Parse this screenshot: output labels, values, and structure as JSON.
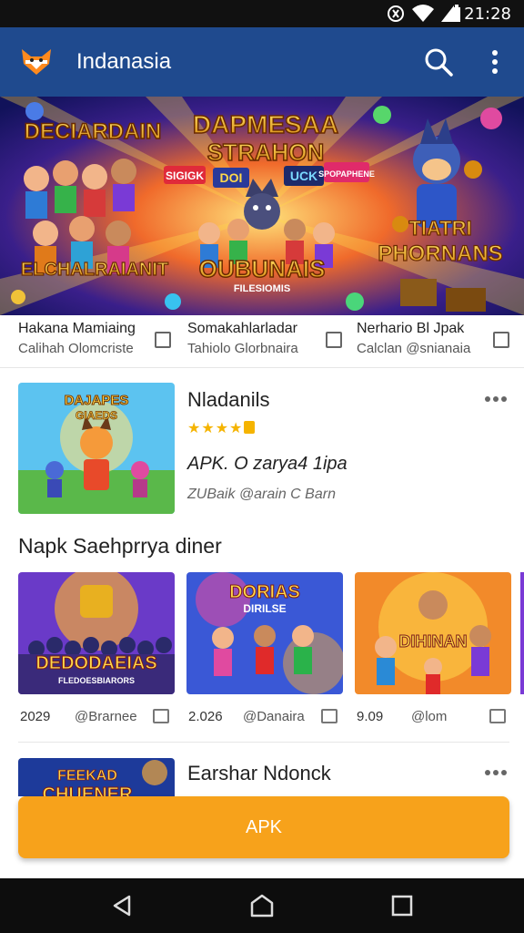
{
  "status_bar": {
    "time": "21:28"
  },
  "appbar": {
    "title": "Indanasia"
  },
  "banner": {
    "headline_left": "DECIARDAIN",
    "headline_center_1": "DAPMESAA",
    "headline_center_2": "STRAHON",
    "tag_1": "SIGIGK",
    "tag_2": "DOI",
    "tag_3": "UCK",
    "tag_4": "SPOPAPHENE",
    "bottom_left": "ELCHALRAIANIT",
    "bottom_center": "OUBUNAIS",
    "bottom_center_sub": "FILESIOMIS",
    "bottom_right_1": "TIATRI",
    "bottom_right_2": "PHORNANS"
  },
  "featured": [
    {
      "title": "Hakana Mamiaing",
      "subtitle": "Calihah Olomcriste"
    },
    {
      "title": "Somakahlarladar",
      "subtitle": "Tahiolo Glorbnaira"
    },
    {
      "title": "Nerhario Bl Jpak",
      "subtitle": "Calclan @snianaia"
    }
  ],
  "app_1": {
    "title": "Nladanils",
    "stars": "★★★★",
    "subtitle": "APK. O zarya4 1ipa",
    "meta": "ZUBaik @arain C Barn",
    "thumb_text_1": "DAJAPES",
    "thumb_text_2": "GIAEDS"
  },
  "section": {
    "title": "Napk Saehprrya diner"
  },
  "tiles": [
    {
      "a": "2029",
      "b": "@Brarnee",
      "img_text_1": "DEDODAEIAS",
      "img_text_2": "FLEDOESBIARORS"
    },
    {
      "a": "2.026",
      "b": "@Danaira",
      "img_text_1": "DORIAS",
      "img_text_2": "DIRILSE"
    },
    {
      "a": "9.09",
      "b": "@lom",
      "img_text_1": "DIHINAN",
      "img_text_2": ""
    }
  ],
  "app_2": {
    "title": "Earshar Ndonck",
    "thumb_text_1": "FEEKAD",
    "thumb_text_2": "CHUENER"
  },
  "apk_button": {
    "label": "APK"
  },
  "colors": {
    "appbar": "#1f4a8e",
    "accent": "#f7a21b",
    "star": "#f5b400"
  }
}
